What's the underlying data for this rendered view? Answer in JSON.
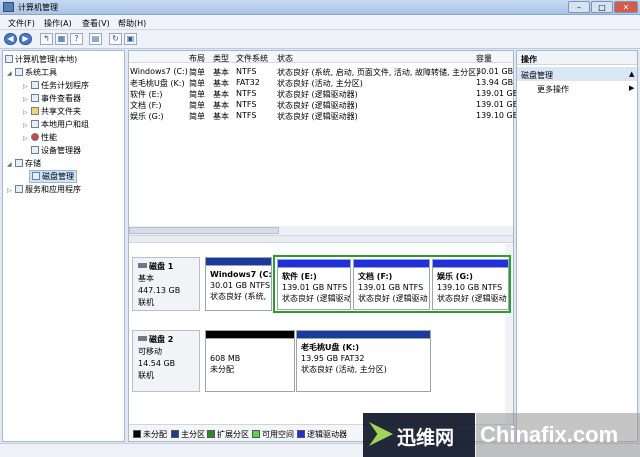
{
  "window": {
    "title": "计算机管理"
  },
  "menu": [
    "文件(F)",
    "操作(A)",
    "查看(V)",
    "帮助(H)"
  ],
  "tree": {
    "root": "计算机管理(本地)",
    "system_tools": "系统工具",
    "task_scheduler": "任务计划程序",
    "event_viewer": "事件查看器",
    "shared_folders": "共享文件夹",
    "users_groups": "本地用户和组",
    "performance": "性能",
    "device_manager": "设备管理器",
    "storage": "存储",
    "disk_management": "磁盘管理",
    "services_apps": "服务和应用程序"
  },
  "volumes": {
    "headers": [
      "布局",
      "类型",
      "文件系统",
      "状态",
      "容量"
    ],
    "rows": [
      {
        "name": "Windows7 (C:)",
        "layout": "简单",
        "type": "基本",
        "fs": "NTFS",
        "status": "状态良好 (系统, 启动, 页面文件, 活动, 故障转储, 主分区)",
        "capacity": "30.01 GB"
      },
      {
        "name": "老毛桃U盘 (K:)",
        "layout": "简单",
        "type": "基本",
        "fs": "FAT32",
        "status": "状态良好 (活动, 主分区)",
        "capacity": "13.94 GB"
      },
      {
        "name": "软件 (E:)",
        "layout": "简单",
        "type": "基本",
        "fs": "NTFS",
        "status": "状态良好 (逻辑驱动器)",
        "capacity": "139.01 GB"
      },
      {
        "name": "文档 (F:)",
        "layout": "简单",
        "type": "基本",
        "fs": "NTFS",
        "status": "状态良好 (逻辑驱动器)",
        "capacity": "139.01 GB"
      },
      {
        "name": "娱乐 (G:)",
        "layout": "简单",
        "type": "基本",
        "fs": "NTFS",
        "status": "状态良好 (逻辑驱动器)",
        "capacity": "139.10 GB"
      }
    ]
  },
  "disk1": {
    "title": "磁盘 1",
    "type": "基本",
    "size": "447.13 GB",
    "status": "联机",
    "partitions": [
      {
        "name": "Windows7 (C:)",
        "size": "30.01 GB NTFS",
        "status": "状态良好 (系统,",
        "color": "#1a3a9c"
      },
      {
        "name": "软件 (E:)",
        "size": "139.01 GB NTFS",
        "status": "状态良好 (逻辑驱动",
        "color": "#2030e0"
      },
      {
        "name": "文档 (F:)",
        "size": "139.01 GB NTFS",
        "status": "状态良好 (逻辑驱动",
        "color": "#2030e0"
      },
      {
        "name": "娱乐 (G:)",
        "size": "139.10 GB NTFS",
        "status": "状态良好 (逻辑驱动",
        "color": "#2030e0"
      }
    ]
  },
  "disk2": {
    "title": "磁盘 2",
    "type": "可移动",
    "size": "14.54 GB",
    "status": "联机",
    "partitions": [
      {
        "name": "",
        "size": "608 MB",
        "status": "未分配",
        "color": "#000000"
      },
      {
        "name": "老毛桃U盘 (K:)",
        "size": "13.95 GB FAT32",
        "status": "状态良好 (活动, 主分区)",
        "color": "#1a3a9c"
      }
    ]
  },
  "legend": [
    {
      "label": "未分配",
      "color": "#000000"
    },
    {
      "label": "主分区",
      "color": "#1a3a9c"
    },
    {
      "label": "扩展分区",
      "color": "#2a8a2a"
    },
    {
      "label": "可用空间",
      "color": "#4fd84f"
    },
    {
      "label": "逻辑驱动器",
      "color": "#2030e0"
    }
  ],
  "actions": {
    "header": "操作",
    "section": "磁盘管理",
    "more": "更多操作"
  },
  "watermark": {
    "brand1": "迅维网",
    "brand2": "Chinafix.com"
  }
}
